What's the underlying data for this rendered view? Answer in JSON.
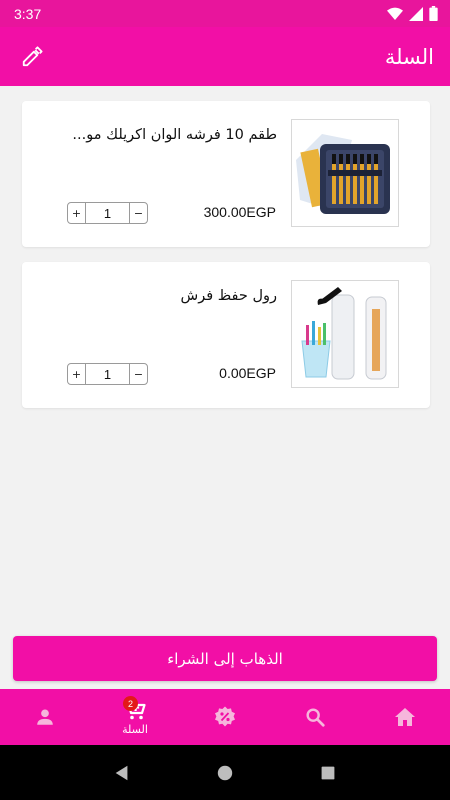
{
  "status_bar": {
    "time": "3:37"
  },
  "app_bar": {
    "title": "السلة",
    "edit_icon": "pencil-icon"
  },
  "cart": {
    "items": [
      {
        "title": "طقم 10 فرشه الوان اكريلك مو...",
        "price": "300.00EGP",
        "quantity": "1",
        "plus": "+",
        "minus": "−"
      },
      {
        "title": "رول حفظ فرش",
        "price": "0.00EGP",
        "quantity": "1",
        "plus": "+",
        "minus": "−"
      }
    ]
  },
  "checkout": {
    "label": "الذهاب إلى الشراء"
  },
  "bottom_nav": {
    "items": [
      {
        "icon": "person-icon",
        "label": ""
      },
      {
        "icon": "cart-icon",
        "label": "السلة",
        "badge": "2",
        "active": true
      },
      {
        "icon": "discount-icon",
        "label": ""
      },
      {
        "icon": "search-icon",
        "label": ""
      },
      {
        "icon": "home-icon",
        "label": ""
      }
    ]
  },
  "colors": {
    "primary": "#f20fa6",
    "status_bar": "#e8159c",
    "badge": "#e31919",
    "background": "#f2f2f2"
  }
}
